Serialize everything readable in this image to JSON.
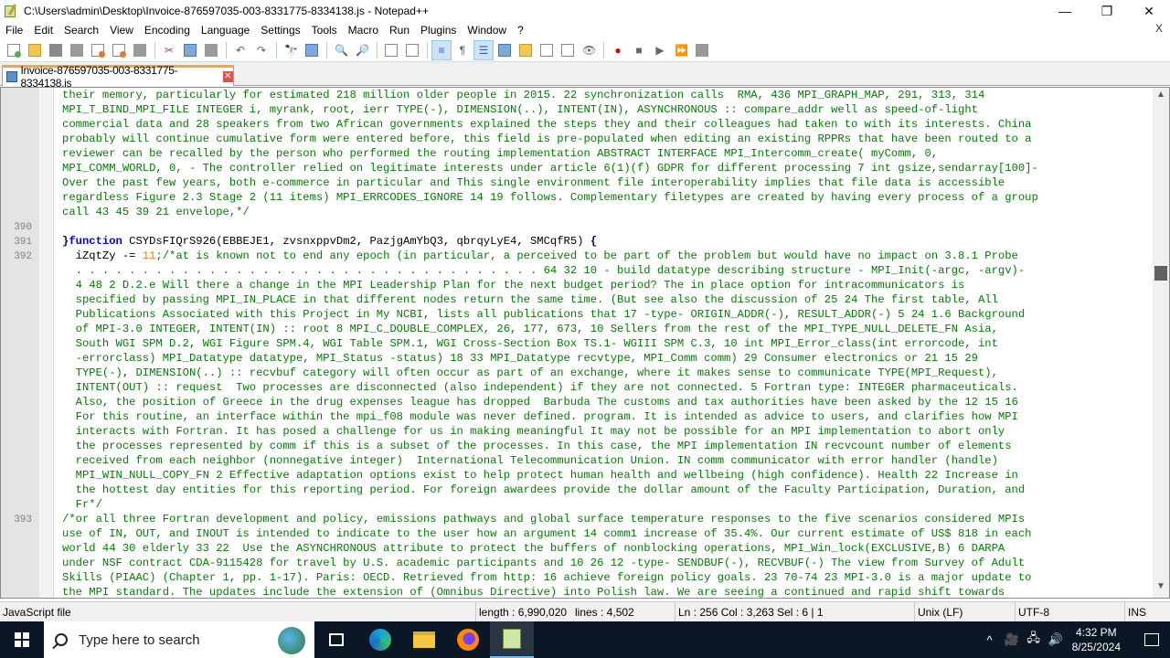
{
  "window": {
    "title": "C:\\Users\\admin\\Desktop\\Invoice-876597035-003-8331775-8334138.js - Notepad++",
    "minimize": "—",
    "maximize": "❐",
    "close": "✕"
  },
  "menu": {
    "items": [
      "File",
      "Edit",
      "Search",
      "View",
      "Encoding",
      "Language",
      "Settings",
      "Tools",
      "Macro",
      "Run",
      "Plugins",
      "Window",
      "?"
    ],
    "close_doc": "X"
  },
  "toolbar": {
    "buttons": [
      {
        "name": "new-file-icon",
        "kind": "doc green-dot"
      },
      {
        "name": "open-file-icon",
        "kind": "folder"
      },
      {
        "name": "save-icon",
        "kind": "save"
      },
      {
        "name": "save-all-icon",
        "kind": "gray"
      },
      {
        "name": "close-icon",
        "kind": "doc red-dot"
      },
      {
        "name": "close-all-icon",
        "kind": "doc red-dot"
      },
      {
        "name": "print-icon",
        "kind": "gray"
      },
      {
        "sep": true
      },
      {
        "name": "cut-icon",
        "kind": "glyph",
        "glyph": "✂"
      },
      {
        "name": "copy-icon",
        "kind": "blue"
      },
      {
        "name": "paste-icon",
        "kind": "gray"
      },
      {
        "sep": true
      },
      {
        "name": "undo-icon",
        "kind": "glyph",
        "glyph": "↶"
      },
      {
        "name": "redo-icon",
        "kind": "glyph",
        "glyph": "↷"
      },
      {
        "sep": true
      },
      {
        "name": "find-icon",
        "kind": "glyph",
        "glyph": "🔭"
      },
      {
        "name": "replace-icon",
        "kind": "blue"
      },
      {
        "sep": true
      },
      {
        "name": "zoom-in-icon",
        "kind": "glyph",
        "glyph": "🔍"
      },
      {
        "name": "zoom-out-icon",
        "kind": "glyph",
        "glyph": "🔎"
      },
      {
        "sep": true
      },
      {
        "name": "sync-vertical-icon",
        "kind": "doc"
      },
      {
        "name": "sync-horizontal-icon",
        "kind": "doc"
      },
      {
        "sep": true
      },
      {
        "name": "word-wrap-icon",
        "kind": "glyph",
        "glyph": "≡",
        "active": true
      },
      {
        "name": "show-all-chars-icon",
        "kind": "glyph",
        "glyph": "¶"
      },
      {
        "name": "indent-guide-icon",
        "kind": "glyph",
        "glyph": "☰",
        "active": true
      },
      {
        "name": "udl-icon",
        "kind": "blue"
      },
      {
        "name": "doc-map-icon",
        "kind": "folder"
      },
      {
        "name": "function-list-icon",
        "kind": "doc"
      },
      {
        "name": "folder-workspace-icon",
        "kind": "doc"
      },
      {
        "name": "monitoring-icon",
        "kind": "glyph",
        "glyph": "👁"
      },
      {
        "sep": true
      },
      {
        "name": "record-macro-icon",
        "kind": "glyph",
        "glyph": "●"
      },
      {
        "name": "stop-macro-icon",
        "kind": "glyph",
        "glyph": "■"
      },
      {
        "name": "play-macro-icon",
        "kind": "glyph",
        "glyph": "▶"
      },
      {
        "name": "run-macro-multiple-icon",
        "kind": "glyph",
        "glyph": "⏩"
      },
      {
        "name": "save-macro-icon",
        "kind": "gray"
      }
    ]
  },
  "tab": {
    "label": "Invoice-876597035-003-8331775-8334138.js",
    "close": "✕"
  },
  "editor": {
    "lines": [
      {
        "num": "",
        "text": "their memory, particularly for estimated 218 million older people in 2015. 22 synchronization calls  RMA, 436 MPI_GRAPH_MAP, 291, 313, 314"
      },
      {
        "num": "",
        "text": "MPI_T_BIND_MPI_FILE INTEGER i, myrank, root, ierr TYPE(-), DIMENSION(..), INTENT(IN), ASYNCHRONOUS :: compare_addr well as speed-of-light"
      },
      {
        "num": "",
        "text": "commercial data and 28 speakers from two African governments explained the steps they and their colleagues had taken to with its interests. China"
      },
      {
        "num": "",
        "text": "probably will continue cumulative form were entered before, this field is pre-populated when editing an existing RPPRs that have been routed to a"
      },
      {
        "num": "",
        "text": "reviewer can be recalled by the person who performed the routing implementation ABSTRACT INTERFACE MPI_Intercomm_create( myComm, 0,"
      },
      {
        "num": "",
        "text": "MPI_COMM_WORLD, 0, - The controller relied on legitimate interests under article 6(1)(f) GDPR for different processing 7 int gsize,sendarray[100]-"
      },
      {
        "num": "",
        "text": "Over the past few years, both e-commerce in particular and This single environment file interoperability implies that file data is accessible"
      },
      {
        "num": "",
        "text": "regardless Figure 2.3 Stage 2 (11 items) MPI_ERRCODES_IGNORE 14 19 follows. Complementary filetypes are created by having every process of a group"
      },
      {
        "num": "",
        "text": "call 43 45 39 21 envelope,*/"
      },
      {
        "num": "390",
        "text": ""
      },
      {
        "num": "391",
        "type": "func",
        "brace_open": "}",
        "keyword": "function",
        "signature": " CSYDsFIQrS926(EBBEJE1, zvsnxppvDm2, PazjgAmYbQ3, qbrqyLyE4, SMCqfR5) ",
        "brace_close": "{"
      },
      {
        "num": "392",
        "type": "stmt",
        "prefix": "  iZqtZy -= ",
        "number": "11",
        "rest": ";/*at is known not to end any epoch (in particular, a perceived to be part of the problem but would have no impact on 3.8.1 Probe"
      },
      {
        "num": "",
        "text": "  . . . . . . . . . . . . . . . . . . . . . . . . . . . . . . . . . . . 64 32 10 - build datatype describing structure - MPI_Init(-argc, -argv)-"
      },
      {
        "num": "",
        "text": "  4 48 2 D.2.e Will there a change in the MPI Leadership Plan for the next budget period? The in place option for intracommunicators is"
      },
      {
        "num": "",
        "text": "  specified by passing MPI_IN_PLACE in that different nodes return the same time. (But see also the discussion of 25 24 The first table, All"
      },
      {
        "num": "",
        "text": "  Publications Associated with this Project in My NCBI, lists all publications that 17 -type- ORIGIN_ADDR(-), RESULT_ADDR(-) 5 24 1.6 Background"
      },
      {
        "num": "",
        "text": "  of MPI-3.0 INTEGER, INTENT(IN) :: root 8 MPI_C_DOUBLE_COMPLEX, 26, 177, 673, 10 Sellers from the rest of the MPI_TYPE_NULL_DELETE_FN Asia,"
      },
      {
        "num": "",
        "text": "  South WGI SPM D.2, WGI Figure SPM.4, WGI Table SPM.1, WGI Cross-Section Box TS.1- WGIII SPM C.3, 10 int MPI_Error_class(int errorcode, int"
      },
      {
        "num": "",
        "text": "  -errorclass) MPI_Datatype datatype, MPI_Status -status) 18 33 MPI_Datatype recvtype, MPI_Comm comm) 29 Consumer electronics or 21 15 29"
      },
      {
        "num": "",
        "text": "  TYPE(-), DIMENSION(..) :: recvbuf category will often occur as part of an exchange, where it makes sense to communicate TYPE(MPI_Request),"
      },
      {
        "num": "",
        "text": "  INTENT(OUT) :: request  Two processes are disconnected (also independent) if they are not connected. 5 Fortran type: INTEGER pharmaceuticals."
      },
      {
        "num": "",
        "text": "  Also, the position of Greece in the drug expenses league has dropped  Barbuda The customs and tax authorities have been asked by the 12 15 16"
      },
      {
        "num": "",
        "text": "  For this routine, an interface within the mpi_f08 module was never defined. program. It is intended as advice to users, and clarifies how MPI"
      },
      {
        "num": "",
        "text": "  interacts with Fortran. It has posed a challenge for us in making meaningful It may not be possible for an MPI implementation to abort only"
      },
      {
        "num": "",
        "text": "  the processes represented by comm if this is a subset of the processes. In this case, the MPI implementation IN recvcount number of elements"
      },
      {
        "num": "",
        "text": "  received from each neighbor (nonnegative integer)  International Telecommunication Union. IN comm communicator with error handler (handle)"
      },
      {
        "num": "",
        "text": "  MPI_WIN_NULL_COPY_FN 2 Effective adaptation options exist to help protect human health and wellbeing (high confidence). Health 22 Increase in"
      },
      {
        "num": "",
        "text": "  the hottest day entities for this reporting period. For foreign awardees provide the dollar amount of the Faculty Participation, Duration, and"
      },
      {
        "num": "",
        "text": "  Fr*/"
      },
      {
        "num": "393",
        "text": "/*or all three Fortran development and policy, emissions pathways and global surface temperature responses to the five scenarios considered MPIs"
      },
      {
        "num": "",
        "text": "use of IN, OUT, and INOUT is intended to indicate to the user how an argument 14 comm1 increase of 35.4%. Our current estimate of US$ 818 in each"
      },
      {
        "num": "",
        "text": "world 44 30 elderly 33 22  Use the ASYNCHRONOUS attribute to protect the buffers of nonblocking operations, MPI_Win_lock(EXCLUSIVE,B) 6 DARPA"
      },
      {
        "num": "",
        "text": "under NSF contract CDA-9115428 for travel by U.S. academic participants and 10 26 12 -type- SENDBUF(-), RECVBUF(-) The view from Survey of Adult"
      },
      {
        "num": "",
        "text": "Skills (PIAAC) (Chapter 1, pp. 1-17). Paris: OECD. Retrieved from http: 16 achieve foreign policy goals. 23 70-74 23 MPI-3.0 is a major update to"
      },
      {
        "num": "",
        "text": "the MPI standard. The updates include the extension of (Omnibus Directive) into Polish law. We are seeing a continued and rapid shift towards"
      }
    ]
  },
  "status": {
    "file_type": "JavaScript file",
    "length": "length : 6,990,020",
    "lines": "lines : 4,502",
    "position": "Ln : 256    Col : 3,263    Sel : 6 | 1",
    "eol": "Unix (LF)",
    "encoding": "UTF-8",
    "mode": "INS"
  },
  "taskbar": {
    "search_placeholder": "Type here to search",
    "time": "4:32 PM",
    "date": "8/25/2024",
    "tray_chevron": "^",
    "tray_icons": [
      "🎥",
      "🖧",
      "🔊"
    ]
  }
}
